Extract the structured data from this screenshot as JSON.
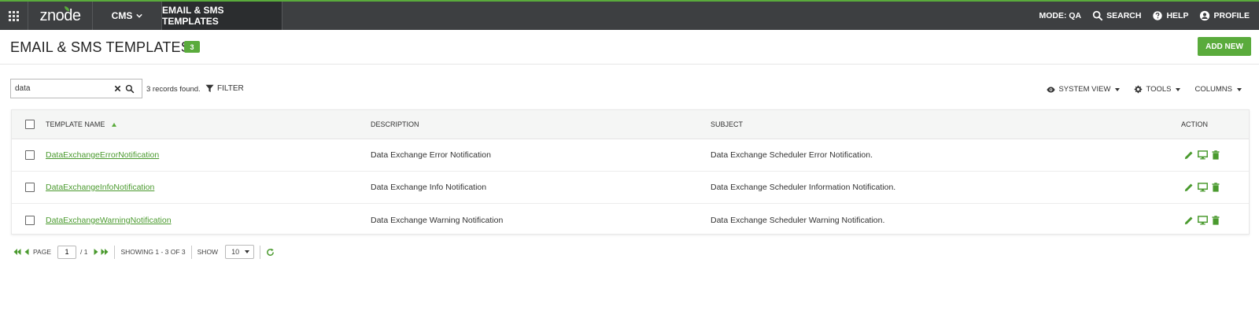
{
  "topbar": {
    "apps_icon": "grid-icon",
    "logo": "znode",
    "menu_cms": "CMS",
    "current_section": "EMAIL & SMS TEMPLATES",
    "mode": "MODE: QA",
    "search": "SEARCH",
    "help": "HELP",
    "profile": "PROFILE"
  },
  "header": {
    "title": "EMAIL & SMS TEMPLATES",
    "count": "3",
    "add_new": "ADD NEW"
  },
  "search": {
    "value": "data",
    "records": "3 records found.",
    "filter": "FILTER"
  },
  "toolbar": {
    "system_view": "SYSTEM VIEW",
    "tools": "TOOLS",
    "columns": "COLUMNS"
  },
  "grid": {
    "columns": {
      "name": "TEMPLATE NAME",
      "description": "DESCRIPTION",
      "subject": "SUBJECT",
      "action": "ACTION"
    },
    "rows": [
      {
        "name": "DataExchangeErrorNotification",
        "description": "Data Exchange Error Notification",
        "subject": "Data Exchange Scheduler Error Notification."
      },
      {
        "name": "DataExchangeInfoNotification",
        "description": "Data Exchange Info Notification",
        "subject": "Data Exchange Scheduler Information Notification."
      },
      {
        "name": "DataExchangeWarningNotification",
        "description": "Data Exchange Warning Notification",
        "subject": "Data Exchange Scheduler Warning Notification."
      }
    ]
  },
  "pager": {
    "page_label": "PAGE",
    "page_value": "1",
    "page_total": "/ 1",
    "showing": "SHOWING 1 - 3 OF 3",
    "show_label": "SHOW",
    "show_value": "10"
  },
  "colors": {
    "accent": "#5aab3c",
    "topbar": "#3d3f41",
    "link": "#4a9a2e"
  }
}
